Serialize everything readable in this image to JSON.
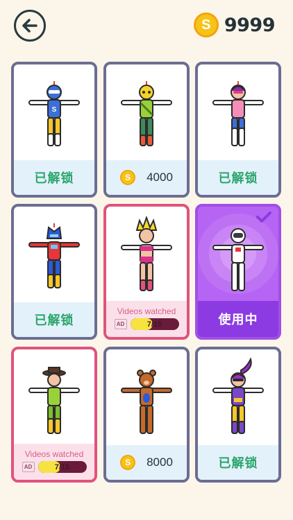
{
  "header": {
    "coin_symbol": "S",
    "coins": "9999"
  },
  "colors": {
    "accent_purple": "#b564f3",
    "pink_border": "#e0537d",
    "border": "#6c6d93",
    "unlock_green": "#2aa56c"
  },
  "cards": [
    {
      "status": "unlocked",
      "label": "已解锁"
    },
    {
      "status": "price",
      "coin_symbol": "S",
      "price": "4000"
    },
    {
      "status": "unlocked",
      "label": "已解锁"
    },
    {
      "status": "unlocked",
      "label": "已解锁"
    },
    {
      "status": "ad",
      "videos_label": "Videos watched",
      "ad_badge": "AD",
      "progress_text": "7/15",
      "progress_fraction": 0.4667
    },
    {
      "status": "in_use",
      "label": "使用中"
    },
    {
      "status": "ad",
      "videos_label": "Videos watched",
      "ad_badge": "AD",
      "progress_text": "7/15",
      "progress_fraction": 0.4667
    },
    {
      "status": "price",
      "coin_symbol": "S",
      "price": "8000"
    },
    {
      "status": "unlocked",
      "label": "已解锁"
    }
  ]
}
